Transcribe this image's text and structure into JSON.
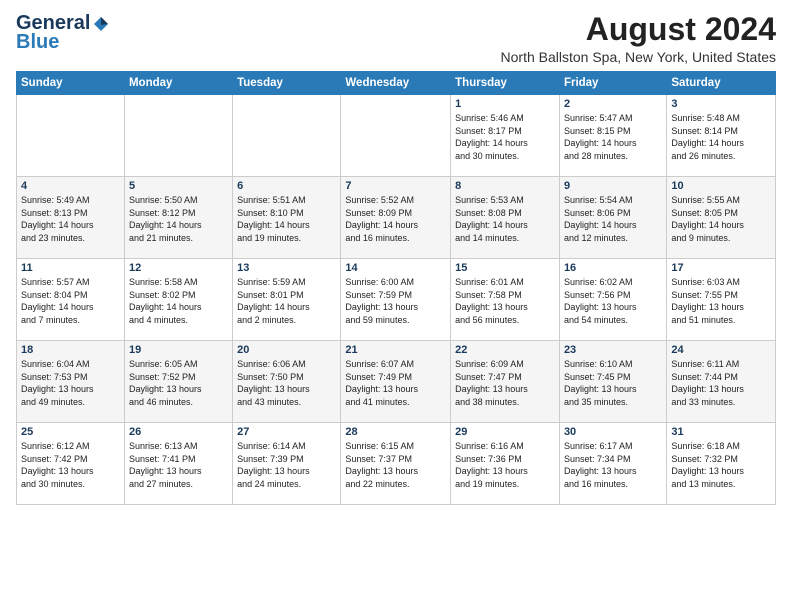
{
  "logo": {
    "line1": "General",
    "line2": "Blue"
  },
  "header": {
    "title": "August 2024",
    "location": "North Ballston Spa, New York, United States"
  },
  "weekdays": [
    "Sunday",
    "Monday",
    "Tuesday",
    "Wednesday",
    "Thursday",
    "Friday",
    "Saturday"
  ],
  "weeks": [
    [
      {
        "day": "",
        "info": ""
      },
      {
        "day": "",
        "info": ""
      },
      {
        "day": "",
        "info": ""
      },
      {
        "day": "",
        "info": ""
      },
      {
        "day": "1",
        "info": "Sunrise: 5:46 AM\nSunset: 8:17 PM\nDaylight: 14 hours\nand 30 minutes."
      },
      {
        "day": "2",
        "info": "Sunrise: 5:47 AM\nSunset: 8:15 PM\nDaylight: 14 hours\nand 28 minutes."
      },
      {
        "day": "3",
        "info": "Sunrise: 5:48 AM\nSunset: 8:14 PM\nDaylight: 14 hours\nand 26 minutes."
      }
    ],
    [
      {
        "day": "4",
        "info": "Sunrise: 5:49 AM\nSunset: 8:13 PM\nDaylight: 14 hours\nand 23 minutes."
      },
      {
        "day": "5",
        "info": "Sunrise: 5:50 AM\nSunset: 8:12 PM\nDaylight: 14 hours\nand 21 minutes."
      },
      {
        "day": "6",
        "info": "Sunrise: 5:51 AM\nSunset: 8:10 PM\nDaylight: 14 hours\nand 19 minutes."
      },
      {
        "day": "7",
        "info": "Sunrise: 5:52 AM\nSunset: 8:09 PM\nDaylight: 14 hours\nand 16 minutes."
      },
      {
        "day": "8",
        "info": "Sunrise: 5:53 AM\nSunset: 8:08 PM\nDaylight: 14 hours\nand 14 minutes."
      },
      {
        "day": "9",
        "info": "Sunrise: 5:54 AM\nSunset: 8:06 PM\nDaylight: 14 hours\nand 12 minutes."
      },
      {
        "day": "10",
        "info": "Sunrise: 5:55 AM\nSunset: 8:05 PM\nDaylight: 14 hours\nand 9 minutes."
      }
    ],
    [
      {
        "day": "11",
        "info": "Sunrise: 5:57 AM\nSunset: 8:04 PM\nDaylight: 14 hours\nand 7 minutes."
      },
      {
        "day": "12",
        "info": "Sunrise: 5:58 AM\nSunset: 8:02 PM\nDaylight: 14 hours\nand 4 minutes."
      },
      {
        "day": "13",
        "info": "Sunrise: 5:59 AM\nSunset: 8:01 PM\nDaylight: 14 hours\nand 2 minutes."
      },
      {
        "day": "14",
        "info": "Sunrise: 6:00 AM\nSunset: 7:59 PM\nDaylight: 13 hours\nand 59 minutes."
      },
      {
        "day": "15",
        "info": "Sunrise: 6:01 AM\nSunset: 7:58 PM\nDaylight: 13 hours\nand 56 minutes."
      },
      {
        "day": "16",
        "info": "Sunrise: 6:02 AM\nSunset: 7:56 PM\nDaylight: 13 hours\nand 54 minutes."
      },
      {
        "day": "17",
        "info": "Sunrise: 6:03 AM\nSunset: 7:55 PM\nDaylight: 13 hours\nand 51 minutes."
      }
    ],
    [
      {
        "day": "18",
        "info": "Sunrise: 6:04 AM\nSunset: 7:53 PM\nDaylight: 13 hours\nand 49 minutes."
      },
      {
        "day": "19",
        "info": "Sunrise: 6:05 AM\nSunset: 7:52 PM\nDaylight: 13 hours\nand 46 minutes."
      },
      {
        "day": "20",
        "info": "Sunrise: 6:06 AM\nSunset: 7:50 PM\nDaylight: 13 hours\nand 43 minutes."
      },
      {
        "day": "21",
        "info": "Sunrise: 6:07 AM\nSunset: 7:49 PM\nDaylight: 13 hours\nand 41 minutes."
      },
      {
        "day": "22",
        "info": "Sunrise: 6:09 AM\nSunset: 7:47 PM\nDaylight: 13 hours\nand 38 minutes."
      },
      {
        "day": "23",
        "info": "Sunrise: 6:10 AM\nSunset: 7:45 PM\nDaylight: 13 hours\nand 35 minutes."
      },
      {
        "day": "24",
        "info": "Sunrise: 6:11 AM\nSunset: 7:44 PM\nDaylight: 13 hours\nand 33 minutes."
      }
    ],
    [
      {
        "day": "25",
        "info": "Sunrise: 6:12 AM\nSunset: 7:42 PM\nDaylight: 13 hours\nand 30 minutes."
      },
      {
        "day": "26",
        "info": "Sunrise: 6:13 AM\nSunset: 7:41 PM\nDaylight: 13 hours\nand 27 minutes."
      },
      {
        "day": "27",
        "info": "Sunrise: 6:14 AM\nSunset: 7:39 PM\nDaylight: 13 hours\nand 24 minutes."
      },
      {
        "day": "28",
        "info": "Sunrise: 6:15 AM\nSunset: 7:37 PM\nDaylight: 13 hours\nand 22 minutes."
      },
      {
        "day": "29",
        "info": "Sunrise: 6:16 AM\nSunset: 7:36 PM\nDaylight: 13 hours\nand 19 minutes."
      },
      {
        "day": "30",
        "info": "Sunrise: 6:17 AM\nSunset: 7:34 PM\nDaylight: 13 hours\nand 16 minutes."
      },
      {
        "day": "31",
        "info": "Sunrise: 6:18 AM\nSunset: 7:32 PM\nDaylight: 13 hours\nand 13 minutes."
      }
    ]
  ]
}
